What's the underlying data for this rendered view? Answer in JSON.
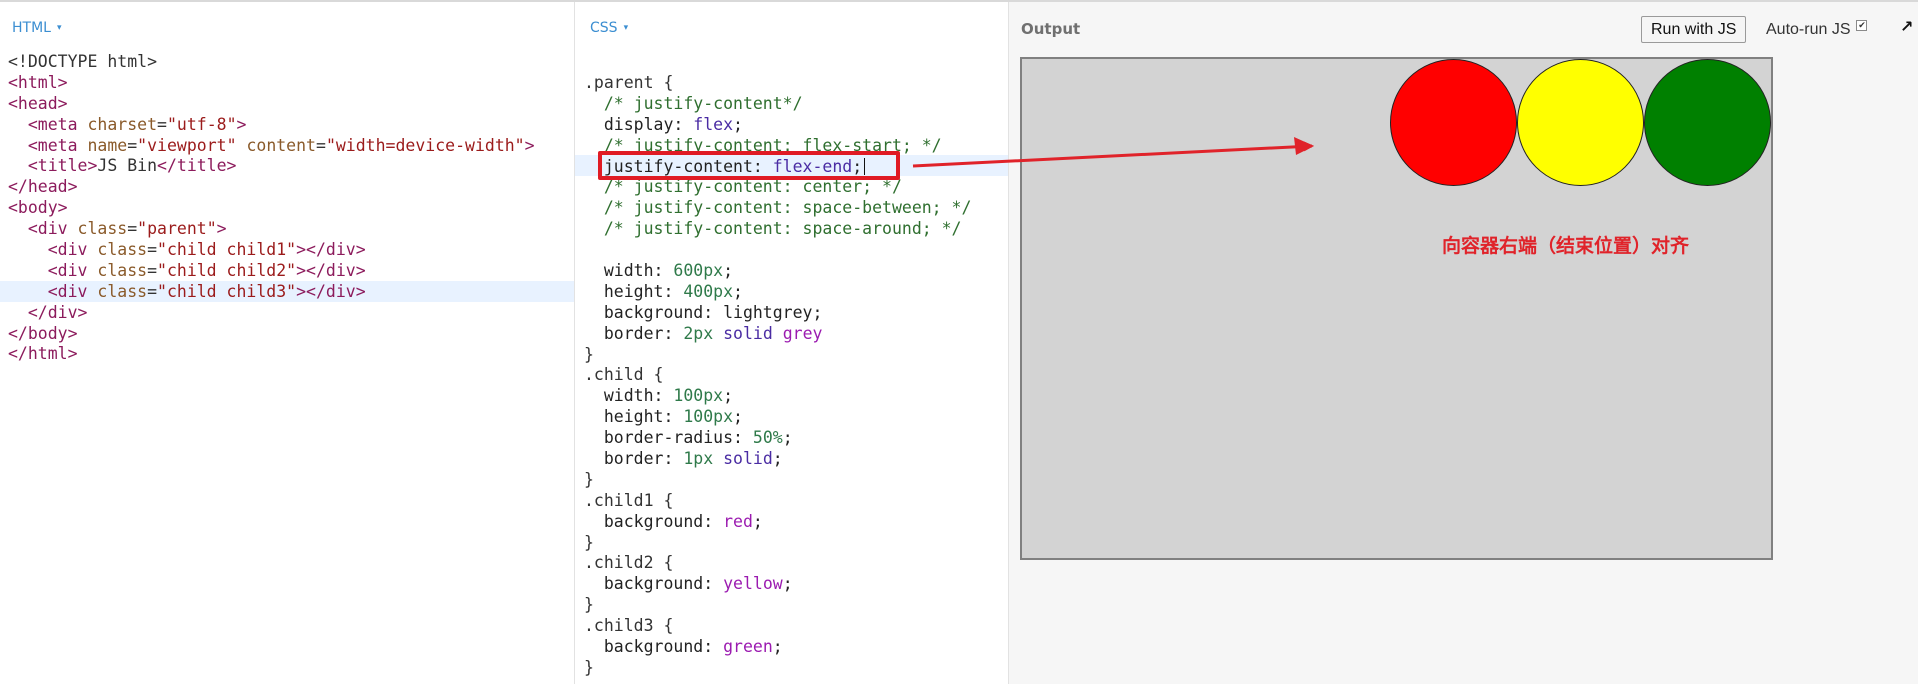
{
  "html_panel": {
    "label": "HTML",
    "caret": "▾",
    "lines": [
      [
        {
          "t": "<!DOCTYPE html>",
          "c": "sel"
        }
      ],
      [
        {
          "t": "<html>",
          "c": "tag"
        }
      ],
      [
        {
          "t": "<head>",
          "c": "tag"
        }
      ],
      [
        {
          "t": "  <meta ",
          "c": "tag"
        },
        {
          "t": "charset",
          "c": "attr"
        },
        {
          "t": "=",
          "c": "sel"
        },
        {
          "t": "\"utf-8\"",
          "c": "str"
        },
        {
          "t": ">",
          "c": "tag"
        }
      ],
      [
        {
          "t": "  <meta ",
          "c": "tag"
        },
        {
          "t": "name",
          "c": "attr"
        },
        {
          "t": "=",
          "c": "sel"
        },
        {
          "t": "\"viewport\"",
          "c": "str"
        },
        {
          "t": " content",
          "c": "attr"
        },
        {
          "t": "=",
          "c": "sel"
        },
        {
          "t": "\"width=device-width\"",
          "c": "str"
        },
        {
          "t": ">",
          "c": "tag"
        }
      ],
      [
        {
          "t": "  <title>",
          "c": "tag"
        },
        {
          "t": "JS Bin",
          "c": "sel"
        },
        {
          "t": "</title>",
          "c": "tag"
        }
      ],
      [
        {
          "t": "</head>",
          "c": "tag"
        }
      ],
      [
        {
          "t": "<body>",
          "c": "tag"
        }
      ],
      [
        {
          "t": "  <div ",
          "c": "tag"
        },
        {
          "t": "class",
          "c": "attr"
        },
        {
          "t": "=",
          "c": "sel"
        },
        {
          "t": "\"parent\"",
          "c": "str"
        },
        {
          "t": ">",
          "c": "tag"
        }
      ],
      [
        {
          "t": "    <div ",
          "c": "tag"
        },
        {
          "t": "class",
          "c": "attr"
        },
        {
          "t": "=",
          "c": "sel"
        },
        {
          "t": "\"child child1\"",
          "c": "str"
        },
        {
          "t": "></div>",
          "c": "tag"
        }
      ],
      [
        {
          "t": "    <div ",
          "c": "tag"
        },
        {
          "t": "class",
          "c": "attr"
        },
        {
          "t": "=",
          "c": "sel"
        },
        {
          "t": "\"child child2\"",
          "c": "str"
        },
        {
          "t": "></div>",
          "c": "tag"
        }
      ],
      [
        {
          "t": "    <div ",
          "c": "tag"
        },
        {
          "t": "class",
          "c": "attr"
        },
        {
          "t": "=",
          "c": "sel"
        },
        {
          "t": "\"child child3\"",
          "c": "str"
        },
        {
          "t": "></div>",
          "c": "tag"
        }
      ],
      [
        {
          "t": "  </div>",
          "c": "tag"
        }
      ],
      [
        {
          "t": "</body>",
          "c": "tag"
        }
      ],
      [
        {
          "t": "</html>",
          "c": "tag"
        }
      ]
    ],
    "active_line": 11
  },
  "css_panel": {
    "label": "CSS",
    "caret": "▾",
    "lines": [
      [
        {
          "t": ".parent {",
          "c": "sel"
        }
      ],
      [
        {
          "t": "  /* justify-content*/",
          "c": "cmt"
        }
      ],
      [
        {
          "t": "  display: ",
          "c": "prop"
        },
        {
          "t": "flex",
          "c": "kw"
        },
        {
          "t": ";",
          "c": "prop"
        }
      ],
      [
        {
          "t": "  /* justify-content: flex-start; */",
          "c": "cmt"
        }
      ],
      [
        {
          "t": "  justify-content: ",
          "c": "prop"
        },
        {
          "t": "flex-end",
          "c": "kw"
        },
        {
          "t": ";",
          "c": "prop"
        }
      ],
      [
        {
          "t": "  /* justify-content: center; */",
          "c": "cmt"
        }
      ],
      [
        {
          "t": "  /* justify-content: space-between; */",
          "c": "cmt"
        }
      ],
      [
        {
          "t": "  /* justify-content: space-around; */",
          "c": "cmt"
        }
      ],
      [
        {
          "t": "",
          "c": "prop"
        }
      ],
      [
        {
          "t": "  width: ",
          "c": "prop"
        },
        {
          "t": "600px",
          "c": "num"
        },
        {
          "t": ";",
          "c": "prop"
        }
      ],
      [
        {
          "t": "  height: ",
          "c": "prop"
        },
        {
          "t": "400px",
          "c": "num"
        },
        {
          "t": ";",
          "c": "prop"
        }
      ],
      [
        {
          "t": "  background: lightgrey;",
          "c": "prop"
        }
      ],
      [
        {
          "t": "  border: ",
          "c": "prop"
        },
        {
          "t": "2px",
          "c": "num"
        },
        {
          "t": " solid ",
          "c": "kw"
        },
        {
          "t": "grey",
          "c": "clr"
        }
      ],
      [
        {
          "t": "}",
          "c": "sel"
        }
      ],
      [
        {
          "t": ".child {",
          "c": "sel"
        }
      ],
      [
        {
          "t": "  width: ",
          "c": "prop"
        },
        {
          "t": "100px",
          "c": "num"
        },
        {
          "t": ";",
          "c": "prop"
        }
      ],
      [
        {
          "t": "  height: ",
          "c": "prop"
        },
        {
          "t": "100px",
          "c": "num"
        },
        {
          "t": ";",
          "c": "prop"
        }
      ],
      [
        {
          "t": "  border-radius: ",
          "c": "prop"
        },
        {
          "t": "50%",
          "c": "num"
        },
        {
          "t": ";",
          "c": "prop"
        }
      ],
      [
        {
          "t": "  border: ",
          "c": "prop"
        },
        {
          "t": "1px",
          "c": "num"
        },
        {
          "t": " solid",
          "c": "kw"
        },
        {
          "t": ";",
          "c": "prop"
        }
      ],
      [
        {
          "t": "}",
          "c": "sel"
        }
      ],
      [
        {
          "t": ".child1 {",
          "c": "sel"
        }
      ],
      [
        {
          "t": "  background: ",
          "c": "prop"
        },
        {
          "t": "red",
          "c": "clr"
        },
        {
          "t": ";",
          "c": "prop"
        }
      ],
      [
        {
          "t": "}",
          "c": "sel"
        }
      ],
      [
        {
          "t": ".child2 {",
          "c": "sel"
        }
      ],
      [
        {
          "t": "  background: ",
          "c": "prop"
        },
        {
          "t": "yellow",
          "c": "clr"
        },
        {
          "t": ";",
          "c": "prop"
        }
      ],
      [
        {
          "t": "}",
          "c": "sel"
        }
      ],
      [
        {
          "t": ".child3 {",
          "c": "sel"
        }
      ],
      [
        {
          "t": "  background: ",
          "c": "prop"
        },
        {
          "t": "green",
          "c": "clr"
        },
        {
          "t": ";",
          "c": "prop"
        }
      ],
      [
        {
          "t": "}",
          "c": "sel"
        }
      ]
    ],
    "active_line": 4
  },
  "output_panel": {
    "title": "Output",
    "run_button": "Run with JS",
    "autorun_label": "Auto-run JS",
    "autorun_checked": "✔",
    "popout_icon": "↗"
  },
  "preview": {
    "background": "#d3d3d3",
    "border_color": "#808080",
    "circles": [
      {
        "name": "child1",
        "color": "#ff0000"
      },
      {
        "name": "child2",
        "color": "#ffff00"
      },
      {
        "name": "child3",
        "color": "#008000"
      }
    ]
  },
  "annotation": {
    "text": "向容器右端（结束位置）对齐",
    "color": "#e0232a"
  }
}
